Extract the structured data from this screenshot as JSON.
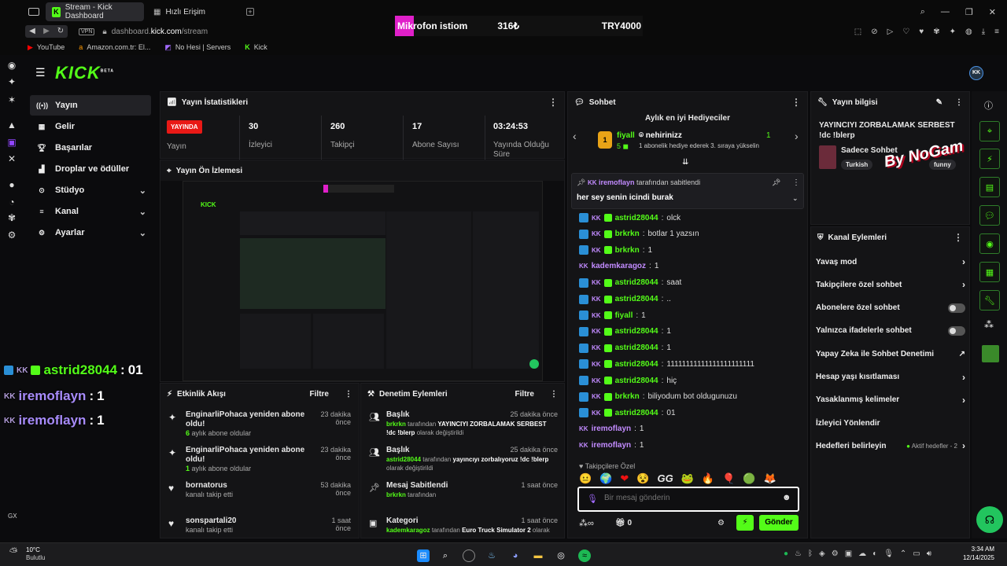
{
  "browser": {
    "tabs": [
      {
        "label": "Stream - Kick Dashboard"
      },
      {
        "label": "Hızlı Erişim"
      }
    ],
    "url_prefix": "dashboard.",
    "url_bold": "kick.com",
    "url_suffix": "/stream",
    "vpn": "VPN",
    "bookmarks": [
      {
        "label": "YouTube"
      },
      {
        "label": "Amazon.com.tr: El..."
      },
      {
        "label": "No Hesi | Servers"
      },
      {
        "label": "Kick"
      }
    ],
    "gx_label": "GX"
  },
  "banner": {
    "name": "Mikrofon istiom",
    "price": "316₺",
    "goal": "TRY4000"
  },
  "kick": {
    "logo": "KICK",
    "logo_beta": "BETA",
    "avatar": "KK",
    "nav": [
      {
        "label": "Yayın",
        "icon": "broadcast-icon",
        "selected": true,
        "chevron": false
      },
      {
        "label": "Gelir",
        "icon": "revenue-icon",
        "selected": false,
        "chevron": false
      },
      {
        "label": "Başarılar",
        "icon": "trophy-icon",
        "selected": false,
        "chevron": false
      },
      {
        "label": "Droplar ve ödüller",
        "icon": "drops-icon",
        "selected": false,
        "chevron": false
      },
      {
        "label": "Stüdyo",
        "icon": "studio-icon",
        "selected": false,
        "chevron": true
      },
      {
        "label": "Kanal",
        "icon": "channel-icon",
        "selected": false,
        "chevron": true
      },
      {
        "label": "Ayarlar",
        "icon": "gear-icon",
        "selected": false,
        "chevron": true
      }
    ],
    "stats": {
      "title": "Yayın İstatistikleri",
      "live_badge": "YAYINDA",
      "items": [
        {
          "value": "",
          "label": "Yayın"
        },
        {
          "value": "30",
          "label": "İzleyici"
        },
        {
          "value": "260",
          "label": "Takipçi"
        },
        {
          "value": "17",
          "label": "Abone Sayısı"
        },
        {
          "value": "03:24:53",
          "label": "Yayında Olduğu Süre"
        }
      ]
    },
    "preview": {
      "title": "Yayın Ön İzlemesi",
      "overlay": [
        {
          "user": "astrid28044",
          "msg": "01",
          "badge": "KK"
        },
        {
          "user": "iremoflayn",
          "msg": "1",
          "badge": "KK"
        },
        {
          "user": "iremoflayn",
          "msg": "1",
          "badge": "KK"
        }
      ]
    },
    "activity": {
      "title": "Etkinlik Akışı",
      "filter": "Filtre",
      "items": [
        {
          "title": "EnginarliPohaca yeniden abone oldu!",
          "count": "6",
          "sub": "aylık abone oldular",
          "time": "23 dakika önce",
          "icon": "sparkle-icon"
        },
        {
          "title": "EnginarliPohaca yeniden abone oldu!",
          "count": "1",
          "sub": "aylık abone oldular",
          "time": "23 dakika önce",
          "icon": "sparkle-icon"
        },
        {
          "title": "bornatorus",
          "count": "",
          "sub": "kanalı takip etti",
          "time": "53 dakika önce",
          "icon": "heart-icon"
        },
        {
          "title": "sonspartali20",
          "count": "",
          "sub": "kanalı takip etti",
          "time": "1 saat önce",
          "icon": "heart-icon"
        }
      ]
    },
    "moderation": {
      "title": "Denetim Eylemleri",
      "filter": "Filtre",
      "items": [
        {
          "title": "Başlık",
          "user": "brkrkn",
          "line": "tarafından",
          "value": "YAYINCIYI ZORBALAMAK SERBEST !dc !blerp",
          "end": "olarak değiştirildi",
          "time": "25 dakika önce",
          "icon": "users-icon"
        },
        {
          "title": "Başlık",
          "user": "astrid28044",
          "line": "tarafından",
          "value": "yayıncıyı zorbalıyoruz !dc !blerp",
          "end": "olarak değiştirildi",
          "time": "25 dakika önce",
          "icon": "users-icon"
        },
        {
          "title": "Mesaj Sabitlendi",
          "user": "brkrkn",
          "line": "tarafından",
          "value": "",
          "end": "",
          "time": "1 saat önce",
          "icon": "pin-icon"
        },
        {
          "title": "Kategori",
          "user": "kademkaragoz",
          "line": "tarafından",
          "value": "Euro Truck Simulator 2",
          "end": "olarak",
          "time": "1 saat önce",
          "icon": "category-icon"
        }
      ]
    },
    "chat": {
      "title": "Sohbet",
      "gifters_title": "Aylık en iyi Hediyeciler",
      "gifter1": {
        "name": "fiyall",
        "count": "5"
      },
      "gifter2": {
        "name": "nehirinizz",
        "count": "1",
        "sub": "1 abonelik hediye ederek 3. sıraya yükselin"
      },
      "pinned_by": "iremoflayn",
      "pinned_label": "tarafından sabitlendi",
      "pinned_msg": "her sey senin icindi burak",
      "messages": [
        {
          "user": "astrid28044",
          "msg": "olck",
          "color": "#53fc18"
        },
        {
          "user": "brkrkn",
          "msg": "botlar 1 yazsın",
          "color": "#53fc18"
        },
        {
          "user": "brkrkn",
          "msg": "1",
          "color": "#53fc18"
        },
        {
          "user": "kademkaragoz",
          "msg": "1",
          "color": "#c28bff"
        },
        {
          "user": "astrid28044",
          "msg": "saat",
          "color": "#53fc18"
        },
        {
          "user": "astrid28044",
          "msg": "..",
          "color": "#53fc18"
        },
        {
          "user": "fiyall",
          "msg": "1",
          "color": "#53fc18"
        },
        {
          "user": "astrid28044",
          "msg": "1",
          "color": "#53fc18"
        },
        {
          "user": "astrid28044",
          "msg": "1",
          "color": "#53fc18"
        },
        {
          "user": "astrid28044",
          "msg": "11111111111111111111111",
          "color": "#53fc18"
        },
        {
          "user": "astrid28044",
          "msg": "hiç",
          "color": "#53fc18"
        },
        {
          "user": "brkrkn",
          "msg": "biliyodum bot oldugunuzu",
          "color": "#53fc18"
        },
        {
          "user": "astrid28044",
          "msg": "01",
          "color": "#53fc18"
        },
        {
          "user": "iremoflayn",
          "msg": "1",
          "color": "#c28bff"
        },
        {
          "user": "iremoflayn",
          "msg": "1",
          "color": "#c28bff"
        }
      ],
      "emote_label": "Takipçilere Özel",
      "input_placeholder": "Bir mesaj gönderin",
      "points": "0",
      "send": "Gönder"
    },
    "info": {
      "title": "Yayın bilgisi",
      "stream_title": "YAYINCIYI ZORBALAMAK SERBEST !dc !blerp",
      "category": "Sadece Sohbet",
      "tags": [
        "Turkish",
        "funny"
      ],
      "watermark": "By NoGam"
    },
    "channel_actions": {
      "title": "Kanal Eylemleri",
      "items": [
        {
          "label": "Yavaş mod",
          "type": "chevron"
        },
        {
          "label": "Takipçilere özel sohbet",
          "type": "chevron"
        },
        {
          "label": "Abonelere özel sohbet",
          "type": "toggle"
        },
        {
          "label": "Yalnızca ifadelerle sohbet",
          "type": "toggle"
        },
        {
          "label": "Yapay Zeka ile Sohbet Denetimi",
          "type": "external"
        },
        {
          "label": "Hesap yaşı kısıtlaması",
          "type": "chevron"
        },
        {
          "label": "Yasaklanmış kelimeler",
          "type": "chevron"
        },
        {
          "label": "İzleyici Yönlendir",
          "type": "none"
        },
        {
          "label": "Hedefleri belirleyin",
          "type": "goals",
          "extra": "Aktif hedefler - 2"
        }
      ]
    }
  },
  "taskbar": {
    "temp": "10°C",
    "weather": "Bulutlu",
    "time": "3:34 AM",
    "date": "12/14/2025"
  }
}
